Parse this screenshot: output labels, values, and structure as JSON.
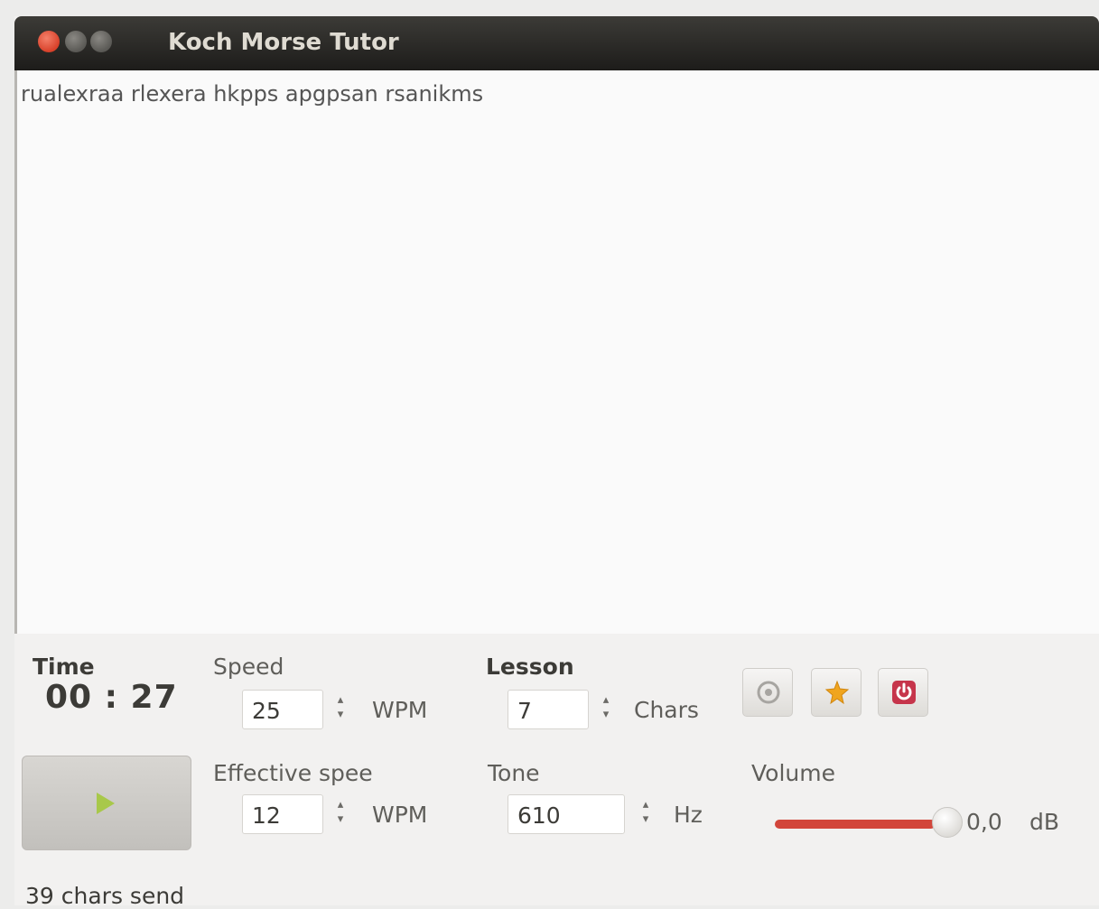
{
  "window": {
    "title": "Koch Morse Tutor"
  },
  "output": {
    "text": "rualexraa rlexera hkpps apgpsan rsanikms"
  },
  "time": {
    "label": "Time",
    "value": "00 : 27"
  },
  "speed": {
    "label": "Speed",
    "value": "25",
    "unit": "WPM"
  },
  "lesson": {
    "label": "Lesson",
    "value": "7",
    "unit": "Chars"
  },
  "effective_speed": {
    "label": "Effective spee",
    "value": "12",
    "unit": "WPM"
  },
  "tone": {
    "label": "Tone",
    "value": "610",
    "unit": "Hz"
  },
  "volume": {
    "label": "Volume",
    "value": "0,0",
    "unit": "dB",
    "level": 1.0
  },
  "toolbar": {
    "icons": [
      "settings-icon",
      "highlight-icon",
      "power-icon"
    ]
  },
  "colors": {
    "accent": "#d2463b",
    "play": "#a8c84a",
    "titlebar": "#2c2b27"
  },
  "status": {
    "text": "39 chars send"
  }
}
